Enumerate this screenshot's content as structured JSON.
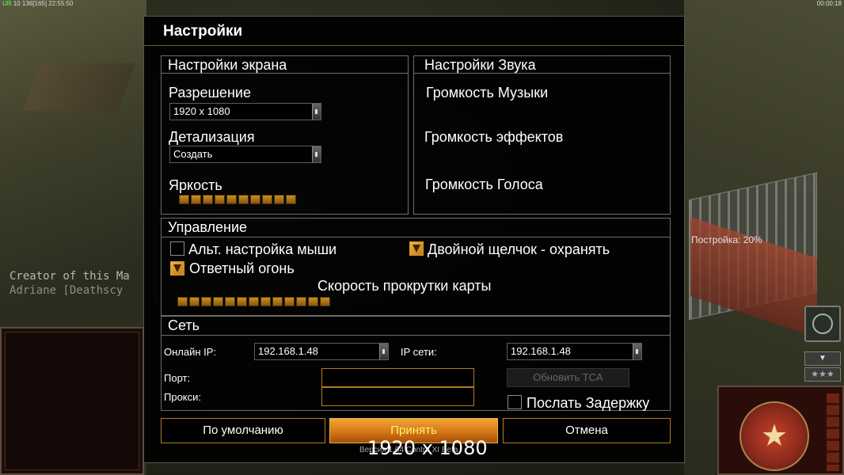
{
  "hud": {
    "top_left_prefix": "UR",
    "top_left_stats": "10 136",
    "top_left_bracket": "[165]",
    "top_left_time": "22:55:50",
    "top_right_time": "00:00:18"
  },
  "background": {
    "credits_line1": "Creator of this Ma",
    "credits_line2": "Adriane [Deathscy",
    "build_progress": "Постройка: 20%"
  },
  "dialog": {
    "title": "Настройки",
    "screen": {
      "header": "Настройки экрана",
      "resolution_label": "Разрешение",
      "resolution_value": "1920 x 1080",
      "detail_label": "Детализация",
      "detail_value": "Создать",
      "brightness_label": "Яркость",
      "brightness_level": 10,
      "brightness_segments": 10
    },
    "sound": {
      "header": "Настройки Звука",
      "music_label": "Громкость Музыки",
      "effects_label": "Громкость эффектов",
      "voice_label": "Громкость Голоса"
    },
    "controls": {
      "header": "Управление",
      "alt_mouse_label": "Альт. настройка мыши",
      "alt_mouse_checked": false,
      "double_click_label": "Двойной щелчок - охранять",
      "double_click_checked": true,
      "return_fire_label": "Ответный огонь",
      "return_fire_checked": true,
      "scroll_speed_label": "Скорость прокрутки карты",
      "scroll_speed_level": 13,
      "scroll_speed_segments": 13
    },
    "network": {
      "header": "Сеть",
      "online_ip_label": "Онлайн IP:",
      "online_ip_value": "192.168.1.48",
      "lan_ip_label": "IP сети:",
      "lan_ip_value": "192.168.1.48",
      "port_label": "Порт:",
      "port_value": "",
      "proxy_label": "Прокси:",
      "proxy_value": "",
      "update_tca_label": "Обновить TCA",
      "send_delay_label": "Послать Задержку",
      "send_delay_checked": false
    },
    "buttons": {
      "default_label": "По умолчанию",
      "accept_label": "Принять",
      "cancel_label": "Отмена"
    },
    "footer": {
      "version_text": "Версия 1.04 Contra XI Beta",
      "resolution_overlay": "1920 x 1080"
    }
  },
  "colors": {
    "accent_orange": "#d87b18",
    "accept_text": "#fff46a",
    "border_gold": "#b27b22"
  }
}
